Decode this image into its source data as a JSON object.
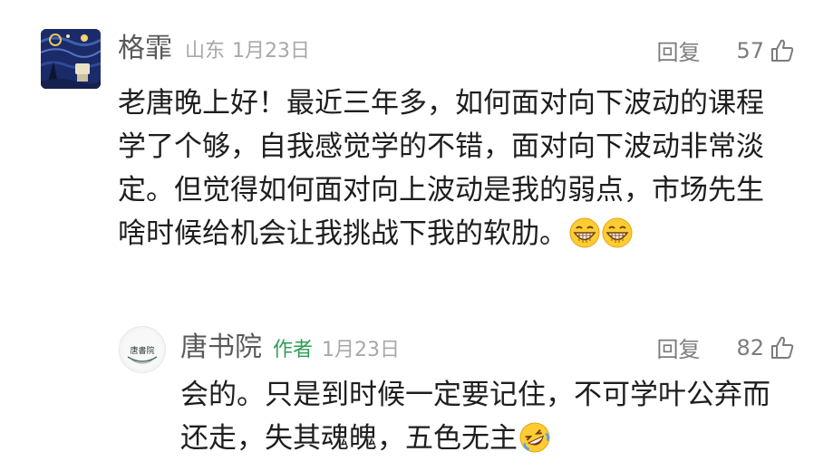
{
  "comments": [
    {
      "name": "格霏",
      "location": "山东",
      "date": "1月23日",
      "reply_label": "回复",
      "likes": "57",
      "text": "老唐晚上好！最近三年多，如何面对向下波动的课程学了个够，自我感觉学的不错，面对向下波动非常淡定。但觉得如何面对向上波动是我的弱点，市场先生啥时候给机会让我挑战下我的软肋。",
      "emojis": [
        "grinning-face-emoji",
        "grinning-face-emoji"
      ]
    },
    {
      "name": "唐书院",
      "author_tag": "作者",
      "date": "1月23日",
      "reply_label": "回复",
      "likes": "82",
      "text": "会的。只是到时候一定要记住，不可学叶公弃而还走，失其魂魄，五色无主",
      "emojis": [
        "rolling-on-floor-laughing-emoji"
      ]
    }
  ],
  "avatar_text": "唐書院",
  "colors": {
    "author_tag": "#2f9e55",
    "meta": "#a8a8a8",
    "name": "#5a5a5a",
    "action": "#7c7c7c"
  }
}
